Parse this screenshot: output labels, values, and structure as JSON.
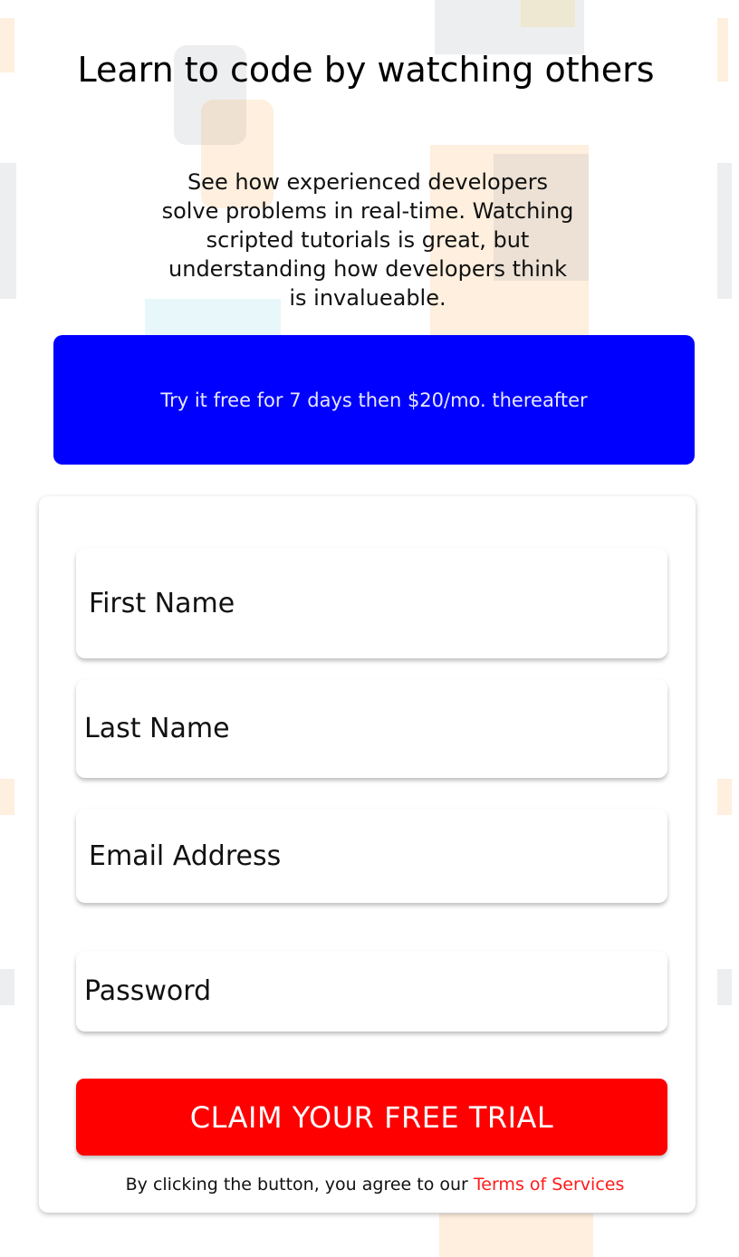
{
  "hero": {
    "title": "Learn to code by watching others",
    "description": "See how experienced developers solve problems in real-time. Watching scripted tutorials is great, but understanding how developers think is invalueable."
  },
  "promo": {
    "text": "Try it free for 7 days then $20/mo. thereafter",
    "color": "#0000ff"
  },
  "form": {
    "first_name_placeholder": "First Name",
    "last_name_placeholder": "Last Name",
    "email_placeholder": "Email Address",
    "password_placeholder": "Password",
    "submit_label": "CLAIM YOUR FREE TRIAL",
    "submit_color": "#ff0000"
  },
  "terms": {
    "prefix": "By clicking the button, you agree to our ",
    "link_label": "Terms of Services"
  }
}
